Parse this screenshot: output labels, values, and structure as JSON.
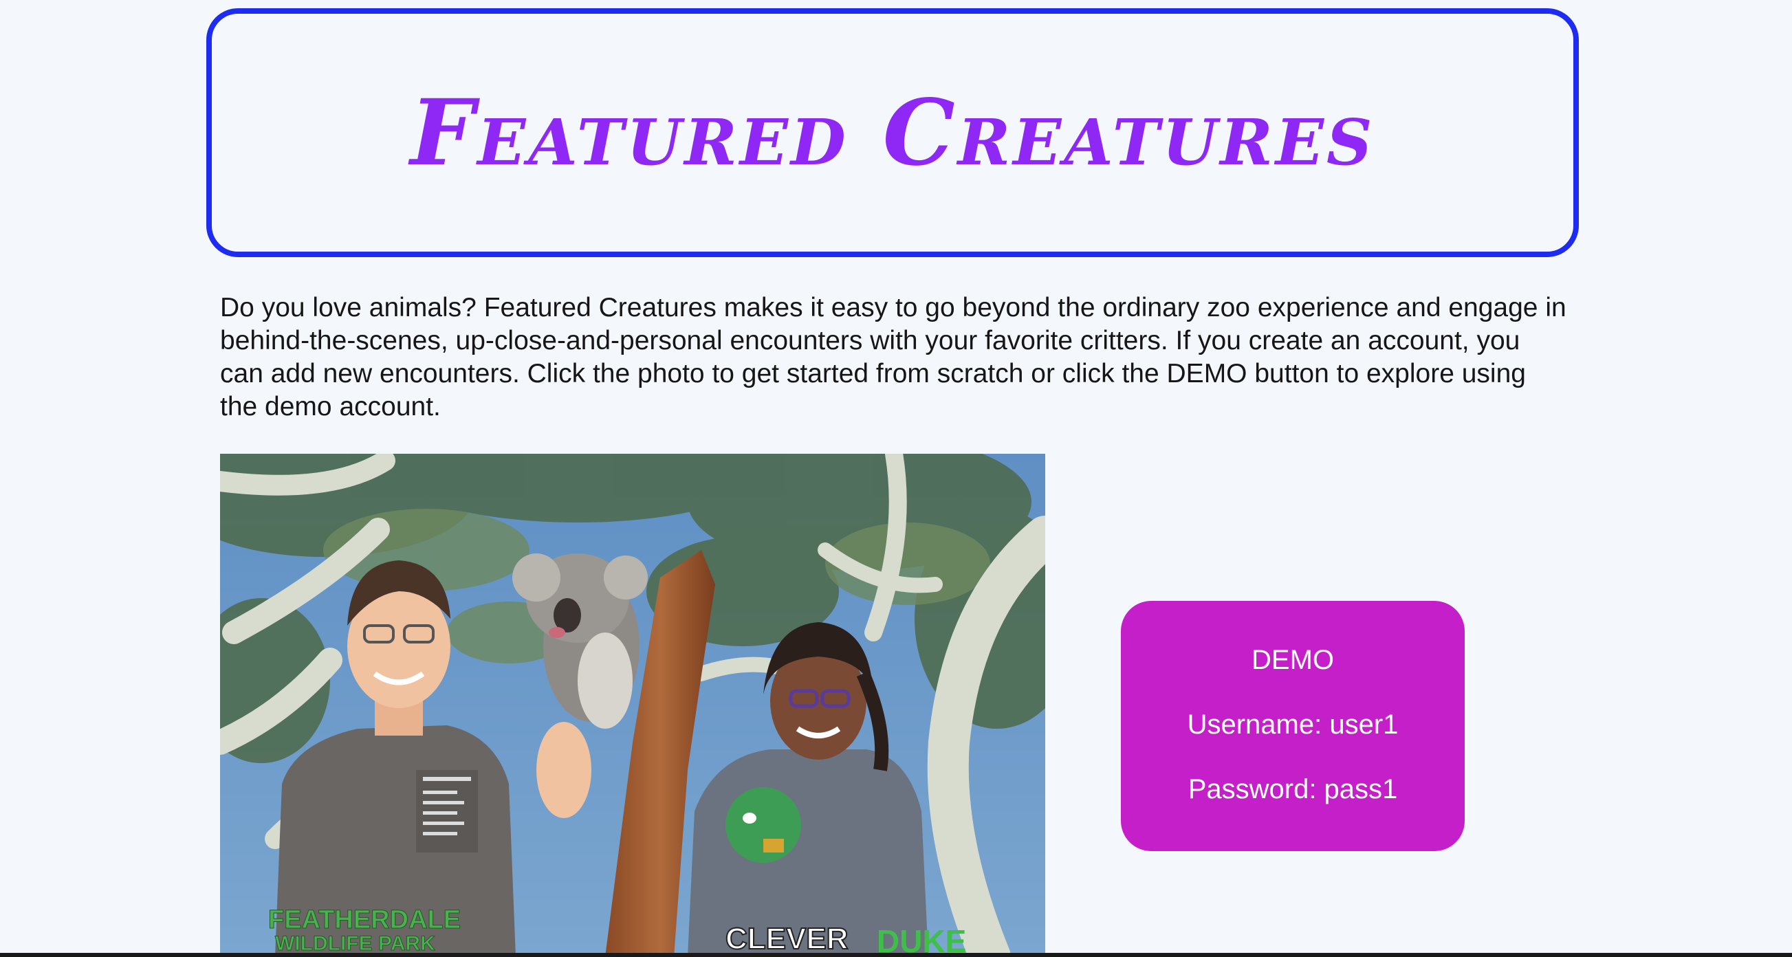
{
  "header": {
    "title": "Featured Creatures"
  },
  "intro": {
    "text": "Do you love animals? Featured Creatures makes it easy to go beyond the ordinary zoo experience and engage in behind-the-scenes, up-close-and-personal encounters with your favorite critters. If you create an account, you can add new encounters. Click the photo to get started from scratch or click the DEMO button to explore using the demo account."
  },
  "photo": {
    "logo_text": [
      "FEATHERDALE",
      "WILDLIFE PARK"
    ],
    "shirt_text": "CLEVER",
    "duke_text": "DUKE"
  },
  "demo": {
    "label": "DEMO",
    "username": "Username: user1",
    "password": "Password: pass1"
  },
  "colors": {
    "background": "#f4f8fd",
    "title": "#9028f5",
    "title_border": "#1e2bf0",
    "demo_button": "#c41fc9"
  }
}
